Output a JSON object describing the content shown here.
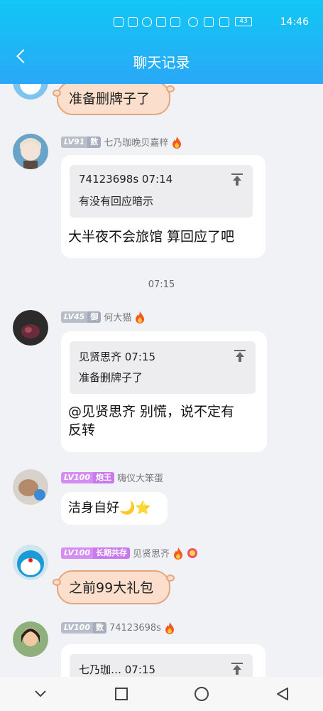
{
  "status_bar": {
    "time": "14:46",
    "battery": "43"
  },
  "header": {
    "title": "聊天记录"
  },
  "messages": [
    {
      "text": "准备删牌子了"
    },
    {
      "level": "LV91",
      "badge": "数",
      "name": "七乃珈晚贝嘉梓",
      "quote_header": "74123698s 07:14",
      "quote_body": "有没有回应暗示",
      "text": "大半夜不会旅馆 算回应了吧"
    },
    {
      "timestamp": "07:15"
    },
    {
      "level": "LV45",
      "badge": "御",
      "name": "何大猫",
      "quote_header": "见贤思齐 07:15",
      "quote_body": "准备删牌子了",
      "text_line1": "@见贤思齐 别慌，说不定有",
      "text_line2": "反转"
    },
    {
      "level": "LV100",
      "badge": "炮王",
      "name": "嗨仪大笨蛋",
      "text": "洁身自好🌙⭐"
    },
    {
      "level": "LV100",
      "badge": "长期共存",
      "name": "见贤思齐",
      "text": "之前99大礼包"
    },
    {
      "level": "LV100",
      "badge": "数",
      "name": "74123698s",
      "quote_header": "七乃珈…  07:15"
    }
  ]
}
